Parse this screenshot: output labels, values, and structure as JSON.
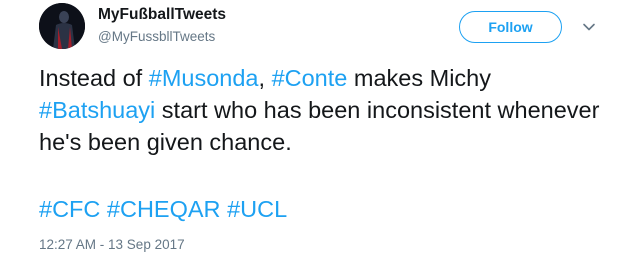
{
  "author": {
    "name": "MyFußballTweets",
    "handle": "@MyFussbllTweets"
  },
  "follow_label": "Follow",
  "icons": {
    "avatar": "profile-photo",
    "more": "chevron-down-icon"
  },
  "tweet": {
    "parts": [
      "Instead of ",
      "#Musonda",
      ", ",
      "#Conte",
      " makes Michy ",
      "#Batshuayi",
      " start who has been inconsistent whenever he's been given chance."
    ],
    "hashtags": [
      "#CFC",
      "#CHEQAR",
      "#UCL"
    ]
  },
  "timestamp": "12:27 AM - 13 Sep 2017",
  "colors": {
    "accent": "#1da1f2",
    "text": "#14171a",
    "muted": "#657786"
  }
}
